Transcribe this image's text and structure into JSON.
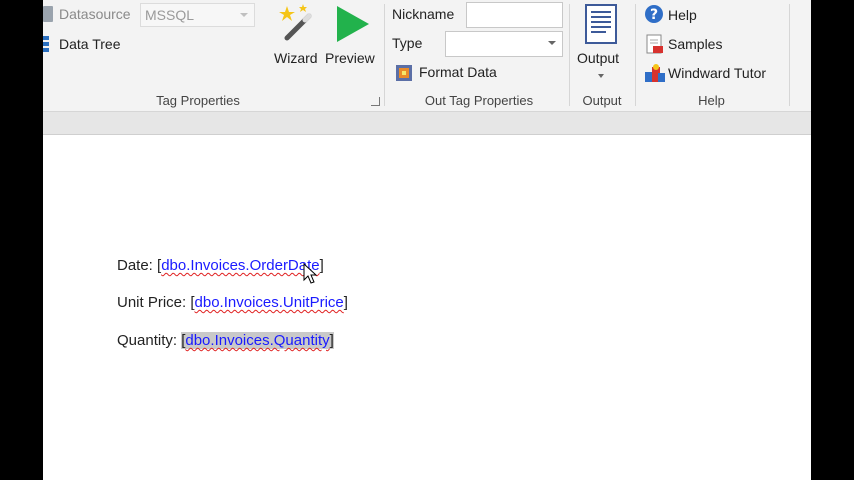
{
  "ribbon": {
    "datasource_label": "Datasource",
    "datasource_value": "MSSQL",
    "data_tree_label": "Data Tree",
    "wizard_label": "Wizard",
    "preview_label": "Preview",
    "tag_properties_group": "Tag Properties",
    "nickname_label": "Nickname",
    "nickname_value": "",
    "type_label": "Type",
    "type_value": "",
    "format_data_label": "Format Data",
    "out_tag_properties_group": "Out Tag Properties",
    "output_button_label": "Output",
    "output_group": "Output",
    "help_label": "Help",
    "samples_label": "Samples",
    "windward_tutor_label": "Windward Tutor",
    "help_group": "Help"
  },
  "document": {
    "lines": [
      {
        "label": "Date:",
        "open": "[",
        "tag": "dbo.Invoices.OrderDate",
        "close": "]"
      },
      {
        "label": "Unit Price:",
        "open": "[",
        "tag": "dbo.Invoices.UnitPrice",
        "close": "]"
      },
      {
        "label": "Quantity:",
        "open": "[",
        "tag": "dbo.Invoices.Quantity",
        "close": "]"
      }
    ]
  },
  "colors": {
    "tag_text": "#1a1aff",
    "spell_underline": "#e02020",
    "selection": "#c9c9c9",
    "preview_green": "#22b24c"
  }
}
